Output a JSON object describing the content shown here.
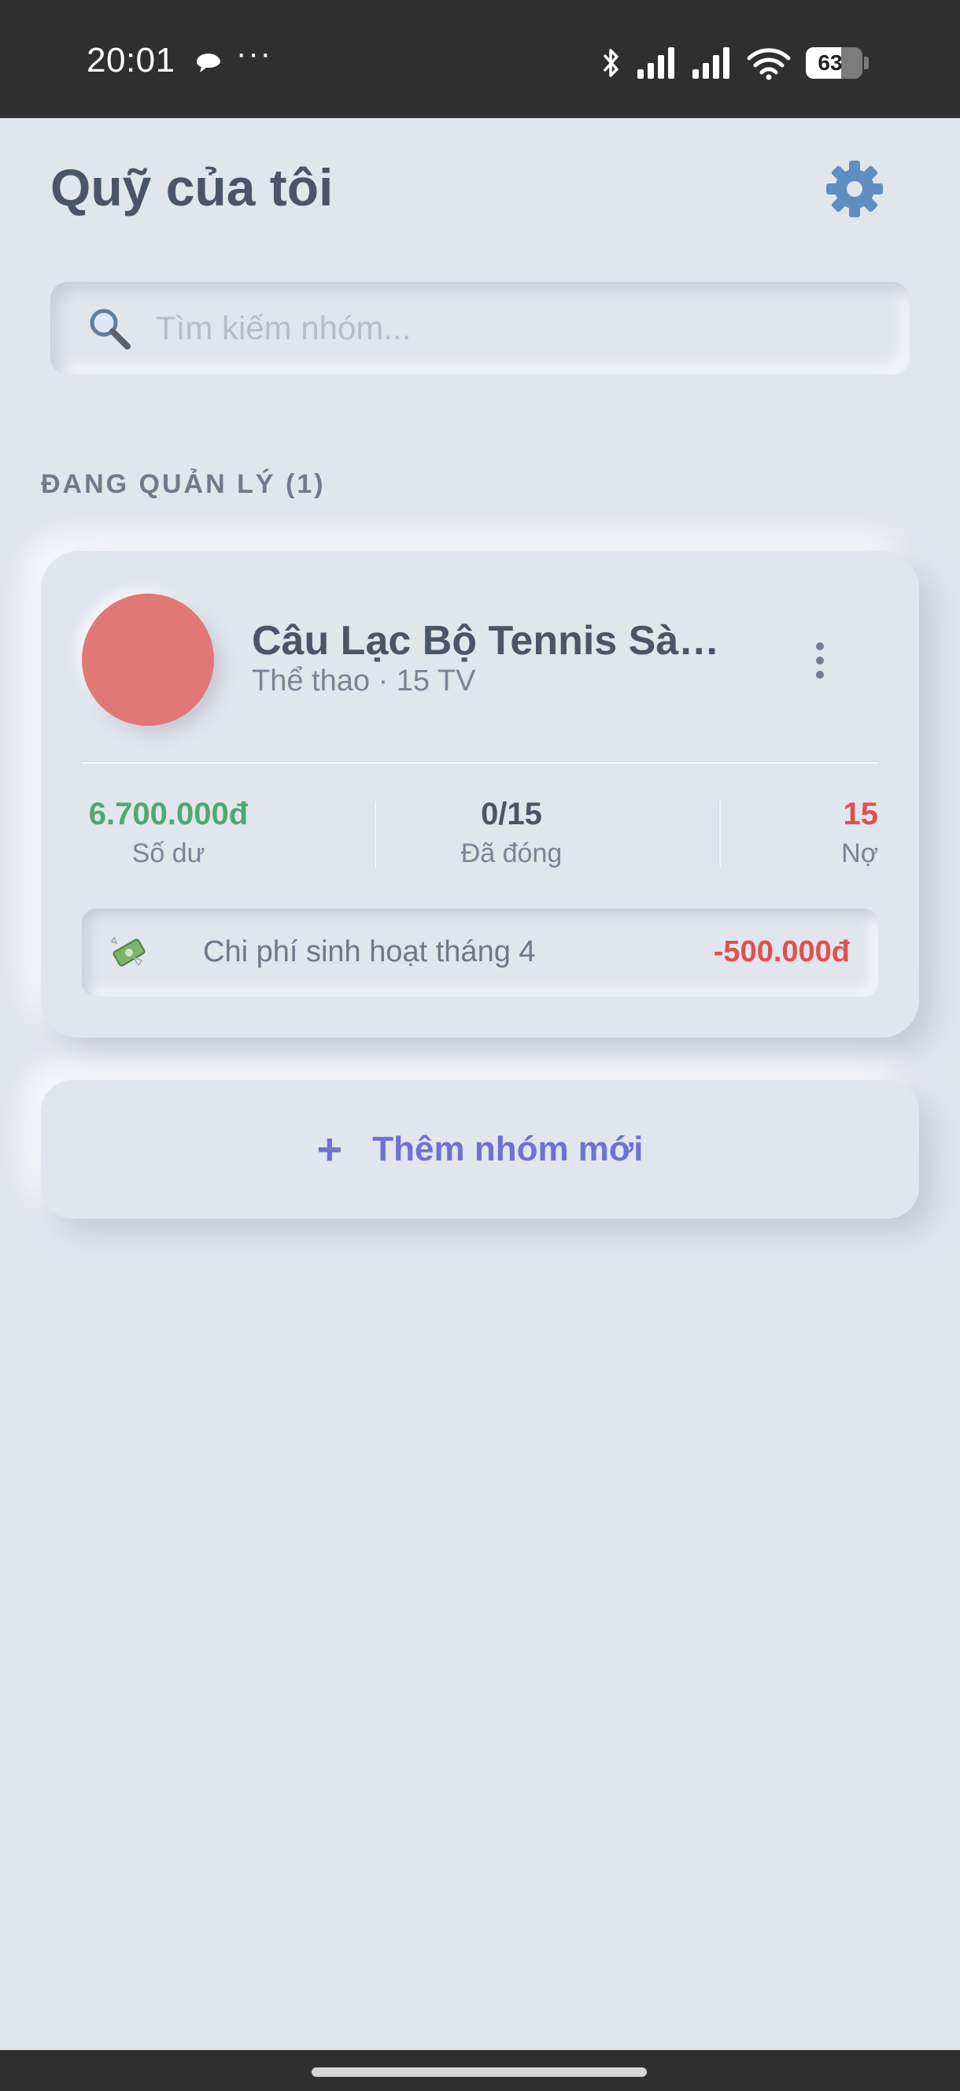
{
  "status_bar": {
    "time": "20:01",
    "more": "···",
    "battery_level": 63,
    "battery_label": "63",
    "icons": [
      "chat-bubble-icon",
      "bluetooth-icon",
      "signal-icon",
      "signal-icon",
      "wifi-icon",
      "battery-icon"
    ]
  },
  "header": {
    "title": "Quỹ của tôi",
    "settings_icon": "gear-icon"
  },
  "search": {
    "placeholder": "Tìm kiếm nhóm...",
    "value": ""
  },
  "section": {
    "label": "ĐANG QUẢN LÝ (1)"
  },
  "groups": [
    {
      "name": "Câu Lạc Bộ Tennis Sài Gòn",
      "meta": "Thể thao · 15 TV",
      "avatar_color": "#e07876",
      "balance": "6.700.000đ",
      "balance_label": "Số dư",
      "paid": "0/15",
      "paid_label": "Đã đóng",
      "debt": "15",
      "debt_label": "Nợ",
      "latest_transaction": {
        "icon": "money-with-wings-icon",
        "label": "Chi phí sinh hoạt tháng 4",
        "amount": "-500.000đ"
      }
    }
  ],
  "add_group": {
    "plus": "+",
    "label": "Thêm nhóm mới"
  },
  "colors": {
    "background": "#e1e5ec",
    "accent": "#6c72d6",
    "positive": "#4fa872",
    "negative": "#e05050",
    "text": "#4c5469"
  }
}
